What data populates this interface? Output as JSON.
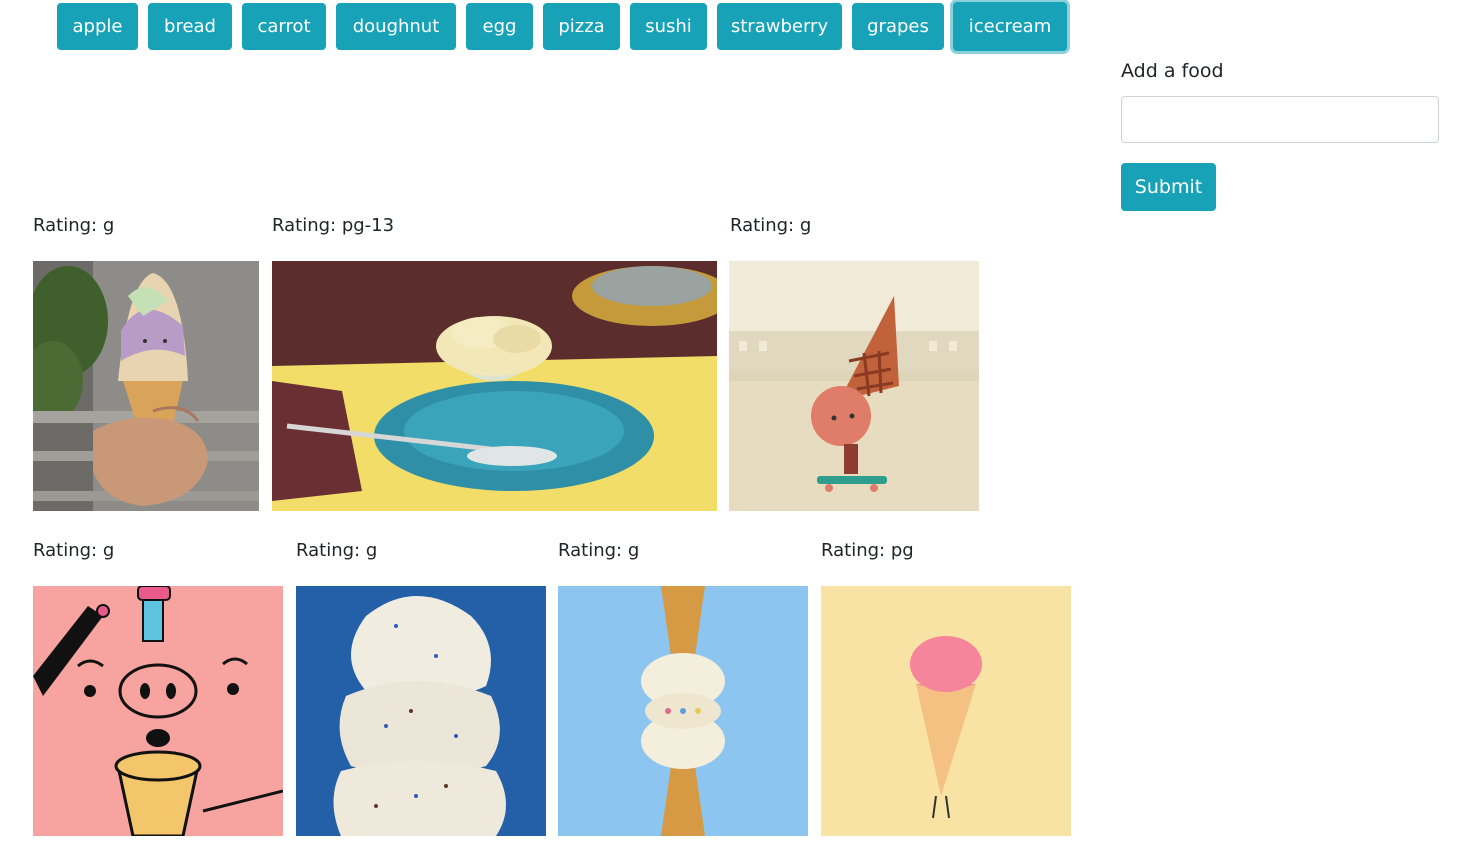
{
  "food_buttons": [
    {
      "label": "apple"
    },
    {
      "label": "bread"
    },
    {
      "label": "carrot"
    },
    {
      "label": "doughnut"
    },
    {
      "label": "egg"
    },
    {
      "label": "pizza"
    },
    {
      "label": "sushi"
    },
    {
      "label": "strawberry"
    },
    {
      "label": "grapes"
    },
    {
      "label": "icecream",
      "active": true
    }
  ],
  "form": {
    "label": "Add a food",
    "input_value": "",
    "input_placeholder": "",
    "submit_label": "Submit"
  },
  "gifs": [
    {
      "rating": "Rating: g",
      "description": "hand holding ice cream cone with face"
    },
    {
      "rating": "Rating: pg-13",
      "description": "ice cream in glass dish on blue plate"
    },
    {
      "rating": "Rating: g",
      "description": "cartoon ice cream cone on skateboard"
    },
    {
      "rating": "Rating: g",
      "description": "cartoon pig eating ice cream cone"
    },
    {
      "rating": "Rating: g",
      "description": "stacked vanilla ice cream scoops"
    },
    {
      "rating": "Rating: g",
      "description": "mirrored ice cream cones on blue"
    },
    {
      "rating": "Rating: pg",
      "description": "cartoon pink ice cream cone walking"
    }
  ],
  "colors": {
    "accent": "#17a2b8",
    "text": "#212529",
    "input_border": "#ced4da"
  }
}
